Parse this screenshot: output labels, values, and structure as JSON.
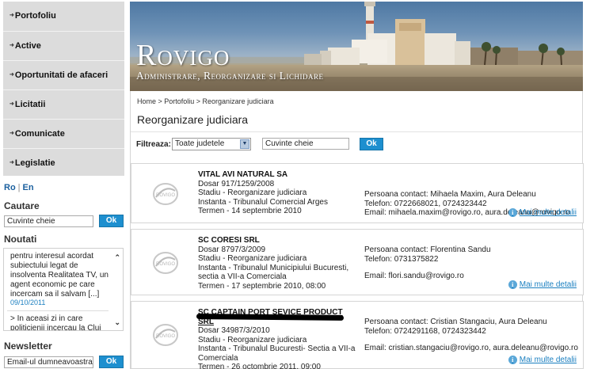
{
  "sidebar": {
    "nav": [
      {
        "label": "Portofoliu"
      },
      {
        "label": "Active"
      },
      {
        "label": "Oportunitati de afaceri"
      },
      {
        "label": "Licitatii"
      },
      {
        "label": "Comunicate"
      },
      {
        "label": "Legislatie"
      }
    ],
    "lang": {
      "ro": "Ro",
      "sep": "|",
      "en": "En"
    },
    "search": {
      "title": "Cautare",
      "value": "Cuvinte cheie",
      "ok": "Ok"
    },
    "news": {
      "title": "Noutati",
      "item1": "pentru interesul acordat subiectului legat de insolventa Realitatea TV, un agent economic pe care incercam sa il salvam [...]",
      "date1": "09/10/2011",
      "item2": "> In aceasi zi in care politicienii incercau la Cluj"
    },
    "newsletter": {
      "title": "Newsletter",
      "value": "Email-ul dumneavoastra",
      "ok": "Ok"
    }
  },
  "banner": {
    "title": "Rovigo",
    "subtitle": "Administrare, Reorganizare si Lichidare"
  },
  "content": {
    "breadcrumb": "Home > Portofoliu > Reorganizare judiciara",
    "title": "Reorganizare judiciara",
    "filter": {
      "label": "Filtreaza:",
      "select": "Toate judetele",
      "keyword": "Cuvinte cheie",
      "ok": "Ok"
    },
    "cards": [
      {
        "name": "VITAL AVI NATURAL SA",
        "dosar": "Dosar 917/1259/2008",
        "stadiu": "Stadiu - Reorganizare judiciara",
        "instanta": "Instanta - Tribunalul Comercial Arges",
        "instanta2": "",
        "termen": "Termen - 14 septembrie 2010",
        "contact": "Persoana contact: Mihaela Maxim, Aura Deleanu",
        "telefon": "Telefon: 0722668021, 0724323442",
        "email": "Email: mihaela.maxim@rovigo.ro, aura.deleanu@rovigo.ro",
        "more": "Mai multe detalii"
      },
      {
        "name": "SC CORESI SRL",
        "dosar": "Dosar 8797/3/2009",
        "stadiu": "Stadiu - Reorganizare judiciara",
        "instanta": "Instanta - Tribunalul Municipiului Bucuresti,",
        "instanta2": "sectia a VII-a Comerciala",
        "termen": "Termen - 17 septembrie 2010, 08:00",
        "contact": "Persoana contact: Florentina Sandu",
        "telefon": "Telefon: 0731375822",
        "email": "Email: flori.sandu@rovigo.ro",
        "more": "Mai multe detalii"
      },
      {
        "name": "SC CAPTAIN PORT SEVICE PRODUCT SRL",
        "dosar": "Dosar 34987/3/2010",
        "stadiu": "Stadiu - Reorganizare judiciara",
        "instanta": "Instanta - Tribunalul Bucuresti- Sectia a VII-a",
        "instanta2": "Comerciala",
        "termen": "Termen - 26 octombrie 2011, 09:00",
        "contact": "Persoana contact: Cristian Stangaciu, Aura Deleanu",
        "telefon": "Telefon: 0724291168, 0724323442",
        "email": "Email: cristian.stangaciu@rovigo.ro, aura.deleanu@rovigo.ro",
        "more": "Mai multe detalii"
      }
    ]
  },
  "colors": {
    "accent": "#1d8fcf",
    "nav_bg": "#dcdcdc",
    "link": "#1a7fc0"
  },
  "icons": [
    "arrow-right-icon",
    "chevron-up-icon",
    "chevron-down-icon",
    "info-icon",
    "rovigo-logo",
    "select-arrow-icon"
  ]
}
